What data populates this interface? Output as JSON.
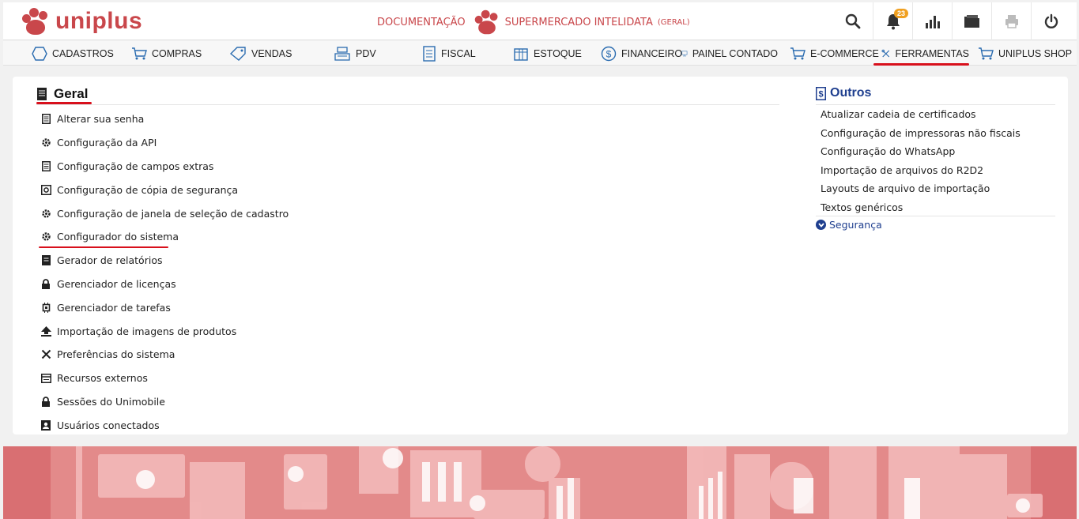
{
  "header": {
    "logo_text": "uniplus",
    "documentation": "DOCUMENTAÇÃO",
    "company": "SUPERMERCADO INTELIDATA",
    "company_sub": "(GERAL)",
    "notifications_count": "23",
    "icons": [
      "search-icon",
      "bell-icon",
      "chart-icon",
      "folder-icon",
      "print-icon",
      "power-icon"
    ]
  },
  "menu": {
    "items": [
      {
        "label": "CADASTROS",
        "icon": "hexagon-icon"
      },
      {
        "label": "COMPRAS",
        "icon": "cart-icon"
      },
      {
        "label": "VENDAS",
        "icon": "tag-icon"
      },
      {
        "label": "PDV",
        "icon": "register-icon"
      },
      {
        "label": "FISCAL",
        "icon": "document-icon"
      },
      {
        "label": "ESTOQUE",
        "icon": "box-icon"
      },
      {
        "label": "FINANCEIRO",
        "icon": "dollar-icon"
      },
      {
        "label": "PAINEL CONTADO",
        "icon": "monitor-icon"
      },
      {
        "label": "E-COMMERCE",
        "icon": "cart-icon"
      },
      {
        "label": "FERRAMENTAS",
        "icon": "tools-icon",
        "active": true
      },
      {
        "label": "UNIPLUS SHOP",
        "icon": "cart-icon"
      }
    ]
  },
  "geral": {
    "title": "Geral",
    "items": [
      {
        "label": "Alterar sua senha",
        "icon": "document-icon"
      },
      {
        "label": "Configuração da API",
        "icon": "gear-icon"
      },
      {
        "label": "Configuração de campos extras",
        "icon": "document-icon"
      },
      {
        "label": "Configuração de cópia de segurança",
        "icon": "backup-icon"
      },
      {
        "label": "Configuração de janela de seleção de cadastro",
        "icon": "gear-icon"
      },
      {
        "label": "Configurador do sistema",
        "icon": "gear-icon"
      },
      {
        "label": "Gerador de relatórios",
        "icon": "report-icon"
      },
      {
        "label": "Gerenciador de licenças",
        "icon": "lock-icon"
      },
      {
        "label": "Gerenciador de tarefas",
        "icon": "chip-icon"
      },
      {
        "label": "Importação de imagens de produtos",
        "icon": "upload-icon"
      },
      {
        "label": "Preferências do sistema",
        "icon": "tools-icon"
      },
      {
        "label": "Recursos externos",
        "icon": "list-icon"
      },
      {
        "label": "Sessões do Unimobile",
        "icon": "lock-icon"
      },
      {
        "label": "Usuários conectados",
        "icon": "user-icon"
      }
    ]
  },
  "outros": {
    "title": "Outros",
    "items": [
      "Atualizar cadeia de certificados",
      "Configuração de impressoras não fiscais",
      "Configuração do WhatsApp",
      "Importação de arquivos do R2D2",
      "Layouts de arquivo de importação",
      "Textos genéricos"
    ],
    "seguranca": "Segurança"
  },
  "colors": {
    "brand": "#c9474b",
    "accent_underline": "#d8101c",
    "outros_blue": "#1f3f8f",
    "banner": "#e38a8a"
  }
}
